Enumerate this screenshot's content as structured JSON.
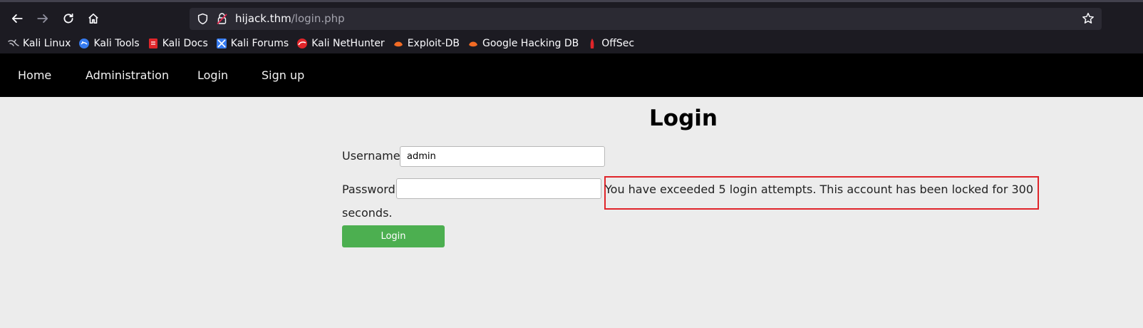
{
  "browser": {
    "url_host": "hijack.thm",
    "url_path": "/login.php",
    "bookmarks": [
      {
        "label": "Kali Linux",
        "icon": "kali-dragon-icon"
      },
      {
        "label": "Kali Tools",
        "icon": "kali-tools-icon"
      },
      {
        "label": "Kali Docs",
        "icon": "kali-docs-icon"
      },
      {
        "label": "Kali Forums",
        "icon": "kali-forums-icon"
      },
      {
        "label": "Kali NetHunter",
        "icon": "nethunter-icon"
      },
      {
        "label": "Exploit-DB",
        "icon": "exploit-db-icon"
      },
      {
        "label": "Google Hacking DB",
        "icon": "ghdb-icon"
      },
      {
        "label": "OffSec",
        "icon": "offsec-icon"
      }
    ]
  },
  "site": {
    "nav": [
      "Home",
      "Administration",
      "Login",
      "Sign up"
    ],
    "title": "Login",
    "username_label": "Username",
    "username_value": "admin",
    "password_label": "Password",
    "password_value": "",
    "error_line1": "You have exceeded 5 login attempts. This account has been locked for 300",
    "error_line2": "seconds.",
    "login_button": "Login"
  },
  "colors": {
    "chrome_bg": "#1c1b22",
    "urlbar_bg": "#2b2a33",
    "nav_bg": "#000000",
    "page_bg": "#ececec",
    "button_green": "#4caf50",
    "highlight_red": "#e0252a"
  }
}
